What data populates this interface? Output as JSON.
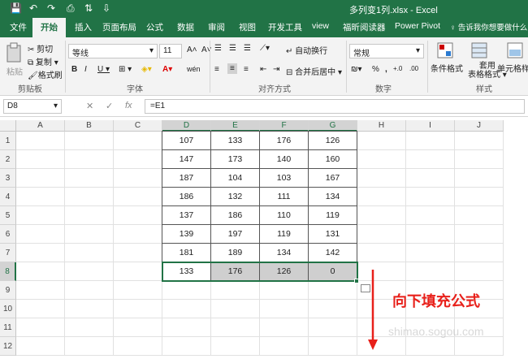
{
  "titlebar": {
    "title": "多列变1列.xlsx  -  Excel",
    "save_icon": "save-icon",
    "undo_icon": "undo-icon",
    "redo_icon": "redo-icon"
  },
  "tabs": [
    "文件",
    "开始",
    "插入",
    "页面布局",
    "公式",
    "数据",
    "审阅",
    "视图",
    "开发工具",
    "view",
    "福昕阅读器",
    "Power Pivot",
    "♀ 告诉我你想要做什么"
  ],
  "active_tab": "开始",
  "ribbon": {
    "clipboard": {
      "paste": "粘贴",
      "cut": "✂ 剪切",
      "copy": "复制 ▾",
      "format_painter": "格式刷",
      "label": "剪贴板"
    },
    "font": {
      "name": "等线",
      "size": "11",
      "grow": "A˄",
      "shrink": "A˅",
      "bold": "B",
      "italic": "I",
      "underline": "U ▾",
      "wen": "wén",
      "label": "字体"
    },
    "alignment": {
      "wrap": "自动换行",
      "merge": "合并后居中 ▾",
      "label": "对齐方式"
    },
    "number": {
      "format": "常规",
      "percent": "%",
      "comma": ",",
      "inc": "+.0",
      "dec": ".00",
      "label": "数字"
    },
    "styles": {
      "conditional": "条件格式",
      "table": "套用\n表格格式 ▾",
      "cell_styles": "单元格样式",
      "label": "样式"
    }
  },
  "formula_bar": {
    "name_box": "D8",
    "fx": "fx",
    "cancel": "✕",
    "enter": "✓",
    "formula": "=E1"
  },
  "columns": [
    "A",
    "B",
    "C",
    "D",
    "E",
    "F",
    "G",
    "H",
    "I",
    "J"
  ],
  "rows": [
    "1",
    "2",
    "3",
    "4",
    "5",
    "6",
    "7",
    "8",
    "9",
    "10",
    "11",
    "12"
  ],
  "table": [
    [
      "107",
      "133",
      "176",
      "126"
    ],
    [
      "147",
      "173",
      "140",
      "160"
    ],
    [
      "187",
      "104",
      "103",
      "167"
    ],
    [
      "186",
      "132",
      "111",
      "134"
    ],
    [
      "137",
      "186",
      "110",
      "119"
    ],
    [
      "139",
      "197",
      "119",
      "131"
    ],
    [
      "181",
      "189",
      "134",
      "142"
    ],
    [
      "133",
      "176",
      "126",
      "0"
    ]
  ],
  "annotation": "向下填充公式",
  "watermark": "shimao.sogou.com",
  "accent_color": "#217346",
  "annotation_color": "#e8201a"
}
